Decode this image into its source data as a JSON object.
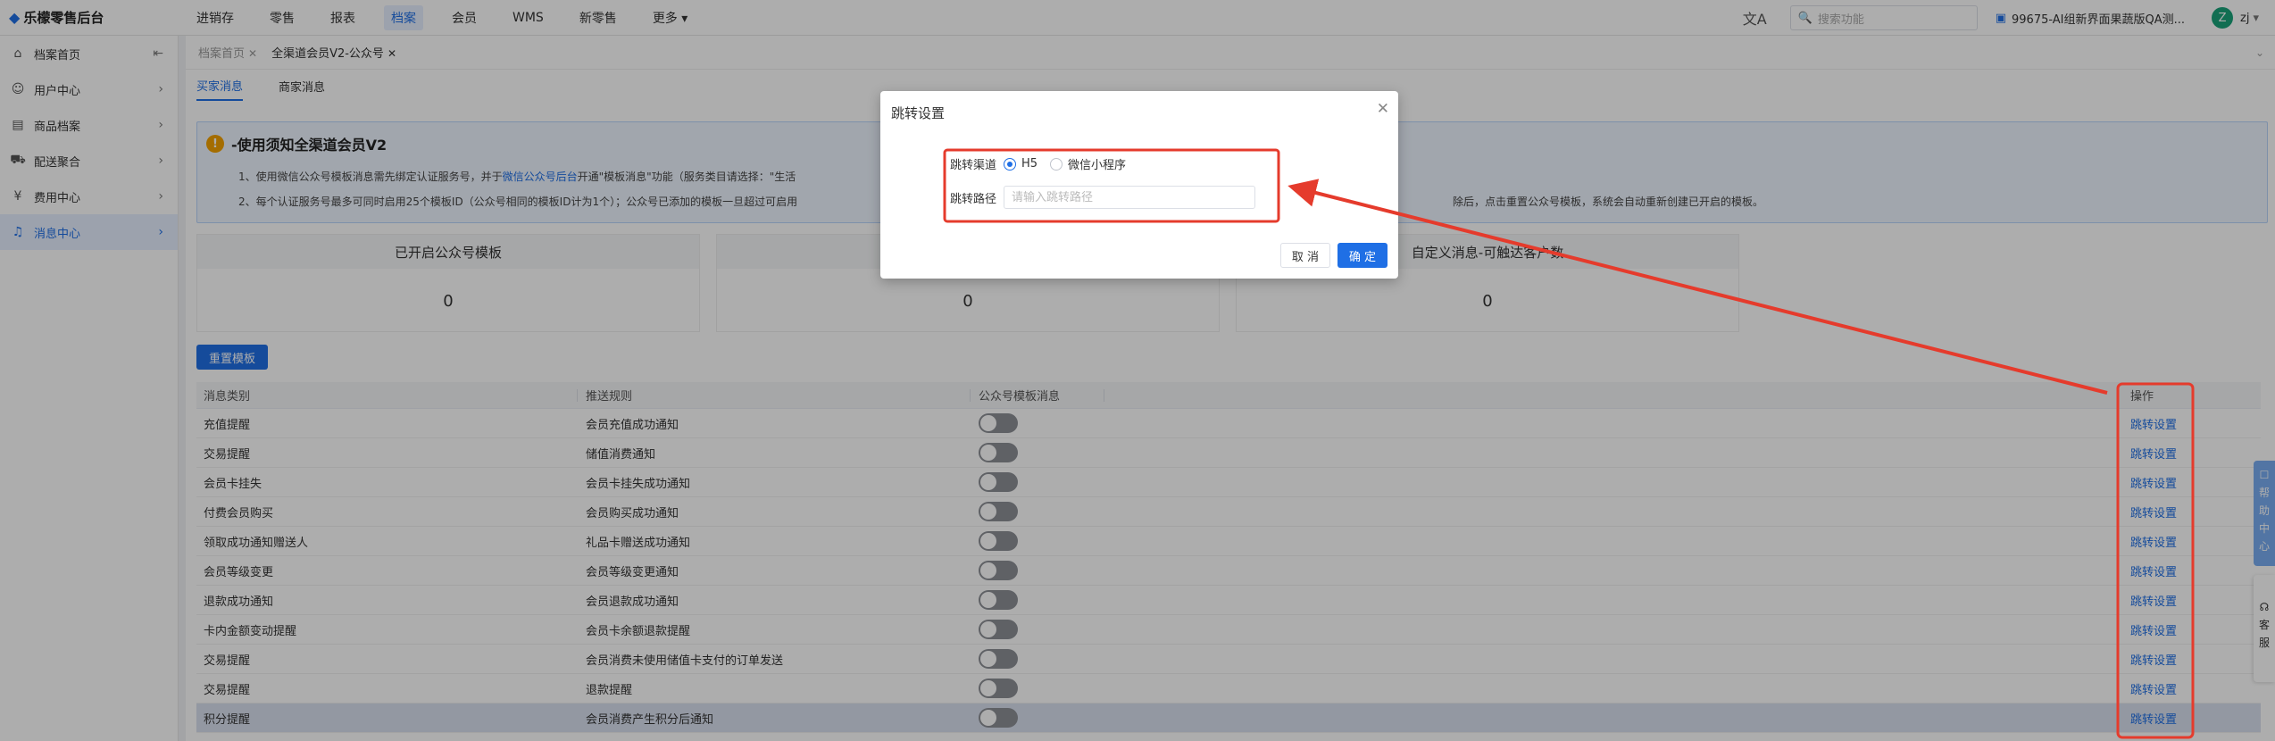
{
  "app": {
    "name": "乐檬零售后台"
  },
  "topnav": {
    "items": [
      "进销存",
      "零售",
      "报表",
      "档案",
      "会员",
      "WMS",
      "新零售",
      "更多"
    ],
    "active_index": 3,
    "search_placeholder": "搜索功能",
    "store": "99675-AI组新界面果蔬版QA测...",
    "user_initial": "Z",
    "user_name": "zj"
  },
  "sidebar": {
    "items": [
      {
        "label": "档案首页",
        "icon": "home-icon"
      },
      {
        "label": "用户中心",
        "icon": "user-icon"
      },
      {
        "label": "商品档案",
        "icon": "box-icon"
      },
      {
        "label": "配送聚合",
        "icon": "truck-icon"
      },
      {
        "label": "费用中心",
        "icon": "money-icon"
      },
      {
        "label": "消息中心",
        "icon": "bell-icon"
      }
    ],
    "active_index": 5
  },
  "tabs": {
    "items": [
      "档案首页",
      "全渠道会员V2-公众号"
    ],
    "active_index": 1
  },
  "subtabs": {
    "items": [
      "买家消息",
      "商家消息"
    ],
    "active_index": 0
  },
  "notice": {
    "title": "-使用须知全渠道会员V2",
    "line1_a": "1、使用微信公众号模板消息需先绑定认证服务号，并于",
    "line1_link": "微信公众号后台",
    "line1_b": "开通\"模板消息\"功能（服务类目请选择：\"生活",
    "line2_a": "2、每个认证服务号最多可同时启用25个模板ID（公众号相同的模板ID计为1个）；公众号已添加的模板一旦超过可启用",
    "line2_b": "除后，点击重置公众号模板，系统会自动重新创建已开启的模板。"
  },
  "stats": [
    {
      "label": "已开启公众号模板",
      "value": "0"
    },
    {
      "label": "",
      "value": "0"
    },
    {
      "label": "自定义消息-可触达客户数",
      "value": "0"
    }
  ],
  "reset_button": "重置模板",
  "table": {
    "headers": [
      "消息类别",
      "推送规则",
      "公众号模板消息",
      "操作"
    ],
    "rows": [
      {
        "category": "充值提醒",
        "rule": "会员充值成功通知",
        "enabled": false,
        "action": "跳转设置"
      },
      {
        "category": "交易提醒",
        "rule": "储值消费通知",
        "enabled": false,
        "action": "跳转设置"
      },
      {
        "category": "会员卡挂失",
        "rule": "会员卡挂失成功通知",
        "enabled": false,
        "action": "跳转设置"
      },
      {
        "category": "付费会员购买",
        "rule": "会员购买成功通知",
        "enabled": false,
        "action": "跳转设置"
      },
      {
        "category": "领取成功通知赠送人",
        "rule": "礼品卡赠送成功通知",
        "enabled": false,
        "action": "跳转设置"
      },
      {
        "category": "会员等级变更",
        "rule": "会员等级变更通知",
        "enabled": false,
        "action": "跳转设置"
      },
      {
        "category": "退款成功通知",
        "rule": "会员退款成功通知",
        "enabled": false,
        "action": "跳转设置"
      },
      {
        "category": "卡内金额变动提醒",
        "rule": "会员卡余额退款提醒",
        "enabled": false,
        "action": "跳转设置"
      },
      {
        "category": "交易提醒",
        "rule": "会员消费未使用储值卡支付的订单发送",
        "enabled": false,
        "action": "跳转设置"
      },
      {
        "category": "交易提醒",
        "rule": "退款提醒",
        "enabled": false,
        "action": "跳转设置"
      },
      {
        "category": "积分提醒",
        "rule": "会员消费产生积分后通知",
        "enabled": false,
        "action": "跳转设置"
      }
    ]
  },
  "modal": {
    "title": "跳转设置",
    "channel_label": "跳转渠道",
    "channel_options": [
      "H5",
      "微信小程序"
    ],
    "channel_selected_index": 0,
    "path_label": "跳转路径",
    "path_placeholder": "请输入跳转路径",
    "path_value": "",
    "cancel_label": "取 消",
    "ok_label": "确 定"
  },
  "float": {
    "help": [
      "帮",
      "助",
      "中",
      "心"
    ],
    "service": [
      "客",
      "服"
    ]
  },
  "colors": {
    "accent": "#1f6fe5",
    "annotation": "#e53b2c",
    "highlight_row": "#d9e0ef"
  }
}
